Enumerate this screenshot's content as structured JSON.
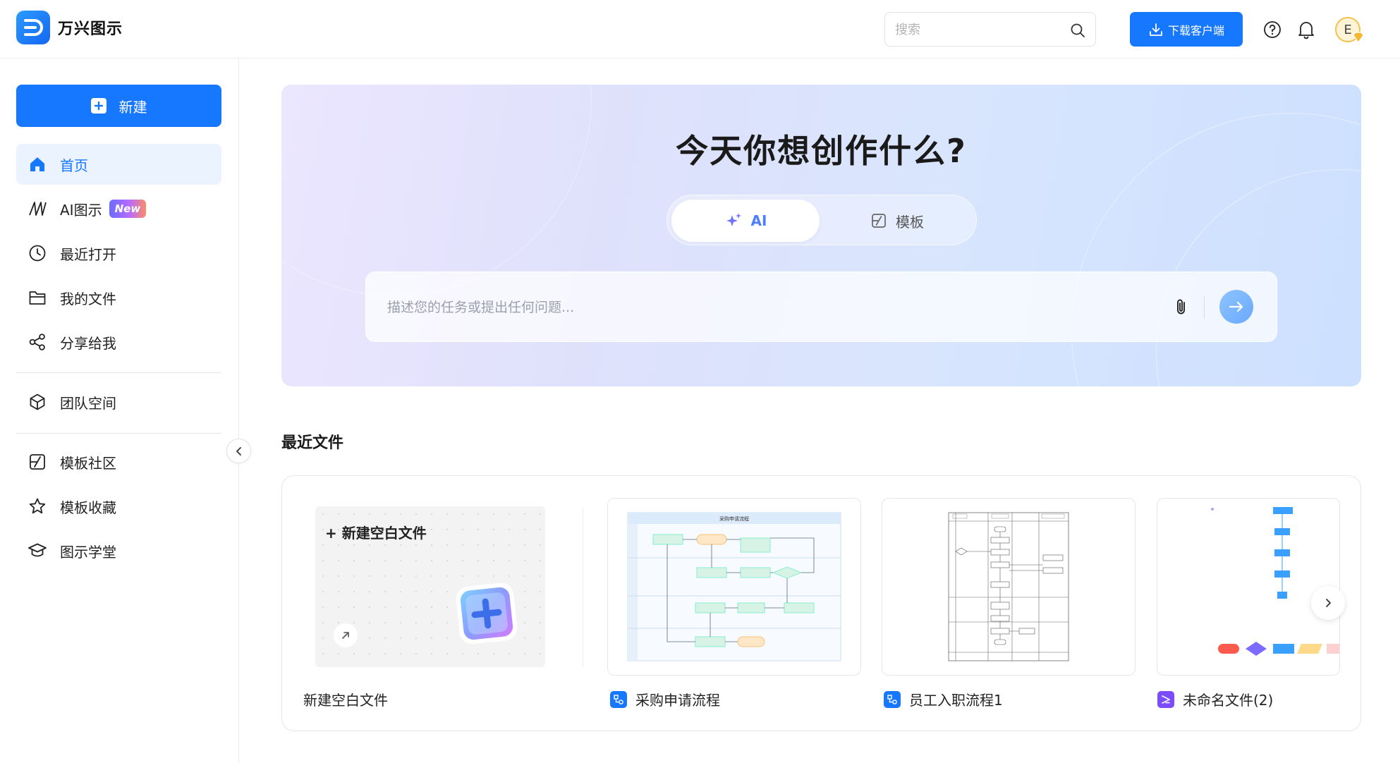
{
  "app": {
    "name": "万兴图示"
  },
  "header": {
    "search_placeholder": "搜索",
    "download_label": "下载客户端",
    "avatar_letter": "E"
  },
  "sidebar": {
    "new_label": "新建",
    "items": [
      {
        "label": "首页",
        "icon": "home-icon",
        "active": true
      },
      {
        "label": "AI图示",
        "icon": "ai-diagram-icon",
        "badge": "New"
      },
      {
        "label": "最近打开",
        "icon": "clock-icon"
      },
      {
        "label": "我的文件",
        "icon": "folder-icon"
      },
      {
        "label": "分享给我",
        "icon": "share-icon"
      },
      {
        "label": "团队空间",
        "icon": "team-space-icon"
      },
      {
        "label": "模板社区",
        "icon": "template-community-icon"
      },
      {
        "label": "模板收藏",
        "icon": "star-icon"
      },
      {
        "label": "图示学堂",
        "icon": "graduation-cap-icon"
      }
    ]
  },
  "hero": {
    "title": "今天你想创作什么?",
    "tabs": [
      {
        "label": "AI",
        "icon": "sparkle-icon",
        "active": true
      },
      {
        "label": "模板",
        "icon": "template-icon"
      }
    ],
    "prompt_placeholder": "描述您的任务或提出任何问题..."
  },
  "recent": {
    "title": "最近文件",
    "blank": {
      "card_title": "+ 新建空白文件",
      "label": "新建空白文件"
    },
    "files": [
      {
        "name": "采购申请流程",
        "icon": "flowchart-file-icon",
        "icon_color": "#1677ff",
        "thumb_title": "采购申请流程"
      },
      {
        "name": "员工入职流程1",
        "icon": "flowchart-file-icon",
        "icon_color": "#1677ff",
        "thumb_title": ""
      },
      {
        "name": "未命名文件(2)",
        "icon": "canvas-file-icon",
        "icon_color": "#7b4dff",
        "thumb_title": ""
      }
    ]
  },
  "colors": {
    "primary": "#1677ff",
    "accent_ai": "#4f7dff"
  }
}
